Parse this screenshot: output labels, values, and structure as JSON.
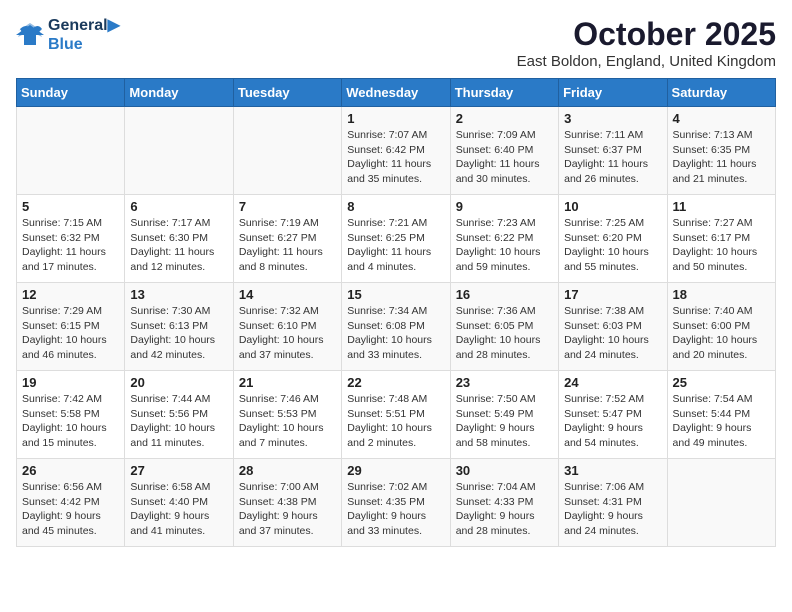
{
  "header": {
    "logo_line1": "General",
    "logo_line2": "Blue",
    "month": "October 2025",
    "location": "East Boldon, England, United Kingdom"
  },
  "days_of_week": [
    "Sunday",
    "Monday",
    "Tuesday",
    "Wednesday",
    "Thursday",
    "Friday",
    "Saturday"
  ],
  "weeks": [
    [
      {
        "day": "",
        "info": ""
      },
      {
        "day": "",
        "info": ""
      },
      {
        "day": "",
        "info": ""
      },
      {
        "day": "1",
        "info": "Sunrise: 7:07 AM\nSunset: 6:42 PM\nDaylight: 11 hours and 35 minutes."
      },
      {
        "day": "2",
        "info": "Sunrise: 7:09 AM\nSunset: 6:40 PM\nDaylight: 11 hours and 30 minutes."
      },
      {
        "day": "3",
        "info": "Sunrise: 7:11 AM\nSunset: 6:37 PM\nDaylight: 11 hours and 26 minutes."
      },
      {
        "day": "4",
        "info": "Sunrise: 7:13 AM\nSunset: 6:35 PM\nDaylight: 11 hours and 21 minutes."
      }
    ],
    [
      {
        "day": "5",
        "info": "Sunrise: 7:15 AM\nSunset: 6:32 PM\nDaylight: 11 hours and 17 minutes."
      },
      {
        "day": "6",
        "info": "Sunrise: 7:17 AM\nSunset: 6:30 PM\nDaylight: 11 hours and 12 minutes."
      },
      {
        "day": "7",
        "info": "Sunrise: 7:19 AM\nSunset: 6:27 PM\nDaylight: 11 hours and 8 minutes."
      },
      {
        "day": "8",
        "info": "Sunrise: 7:21 AM\nSunset: 6:25 PM\nDaylight: 11 hours and 4 minutes."
      },
      {
        "day": "9",
        "info": "Sunrise: 7:23 AM\nSunset: 6:22 PM\nDaylight: 10 hours and 59 minutes."
      },
      {
        "day": "10",
        "info": "Sunrise: 7:25 AM\nSunset: 6:20 PM\nDaylight: 10 hours and 55 minutes."
      },
      {
        "day": "11",
        "info": "Sunrise: 7:27 AM\nSunset: 6:17 PM\nDaylight: 10 hours and 50 minutes."
      }
    ],
    [
      {
        "day": "12",
        "info": "Sunrise: 7:29 AM\nSunset: 6:15 PM\nDaylight: 10 hours and 46 minutes."
      },
      {
        "day": "13",
        "info": "Sunrise: 7:30 AM\nSunset: 6:13 PM\nDaylight: 10 hours and 42 minutes."
      },
      {
        "day": "14",
        "info": "Sunrise: 7:32 AM\nSunset: 6:10 PM\nDaylight: 10 hours and 37 minutes."
      },
      {
        "day": "15",
        "info": "Sunrise: 7:34 AM\nSunset: 6:08 PM\nDaylight: 10 hours and 33 minutes."
      },
      {
        "day": "16",
        "info": "Sunrise: 7:36 AM\nSunset: 6:05 PM\nDaylight: 10 hours and 28 minutes."
      },
      {
        "day": "17",
        "info": "Sunrise: 7:38 AM\nSunset: 6:03 PM\nDaylight: 10 hours and 24 minutes."
      },
      {
        "day": "18",
        "info": "Sunrise: 7:40 AM\nSunset: 6:00 PM\nDaylight: 10 hours and 20 minutes."
      }
    ],
    [
      {
        "day": "19",
        "info": "Sunrise: 7:42 AM\nSunset: 5:58 PM\nDaylight: 10 hours and 15 minutes."
      },
      {
        "day": "20",
        "info": "Sunrise: 7:44 AM\nSunset: 5:56 PM\nDaylight: 10 hours and 11 minutes."
      },
      {
        "day": "21",
        "info": "Sunrise: 7:46 AM\nSunset: 5:53 PM\nDaylight: 10 hours and 7 minutes."
      },
      {
        "day": "22",
        "info": "Sunrise: 7:48 AM\nSunset: 5:51 PM\nDaylight: 10 hours and 2 minutes."
      },
      {
        "day": "23",
        "info": "Sunrise: 7:50 AM\nSunset: 5:49 PM\nDaylight: 9 hours and 58 minutes."
      },
      {
        "day": "24",
        "info": "Sunrise: 7:52 AM\nSunset: 5:47 PM\nDaylight: 9 hours and 54 minutes."
      },
      {
        "day": "25",
        "info": "Sunrise: 7:54 AM\nSunset: 5:44 PM\nDaylight: 9 hours and 49 minutes."
      }
    ],
    [
      {
        "day": "26",
        "info": "Sunrise: 6:56 AM\nSunset: 4:42 PM\nDaylight: 9 hours and 45 minutes."
      },
      {
        "day": "27",
        "info": "Sunrise: 6:58 AM\nSunset: 4:40 PM\nDaylight: 9 hours and 41 minutes."
      },
      {
        "day": "28",
        "info": "Sunrise: 7:00 AM\nSunset: 4:38 PM\nDaylight: 9 hours and 37 minutes."
      },
      {
        "day": "29",
        "info": "Sunrise: 7:02 AM\nSunset: 4:35 PM\nDaylight: 9 hours and 33 minutes."
      },
      {
        "day": "30",
        "info": "Sunrise: 7:04 AM\nSunset: 4:33 PM\nDaylight: 9 hours and 28 minutes."
      },
      {
        "day": "31",
        "info": "Sunrise: 7:06 AM\nSunset: 4:31 PM\nDaylight: 9 hours and 24 minutes."
      },
      {
        "day": "",
        "info": ""
      }
    ]
  ]
}
